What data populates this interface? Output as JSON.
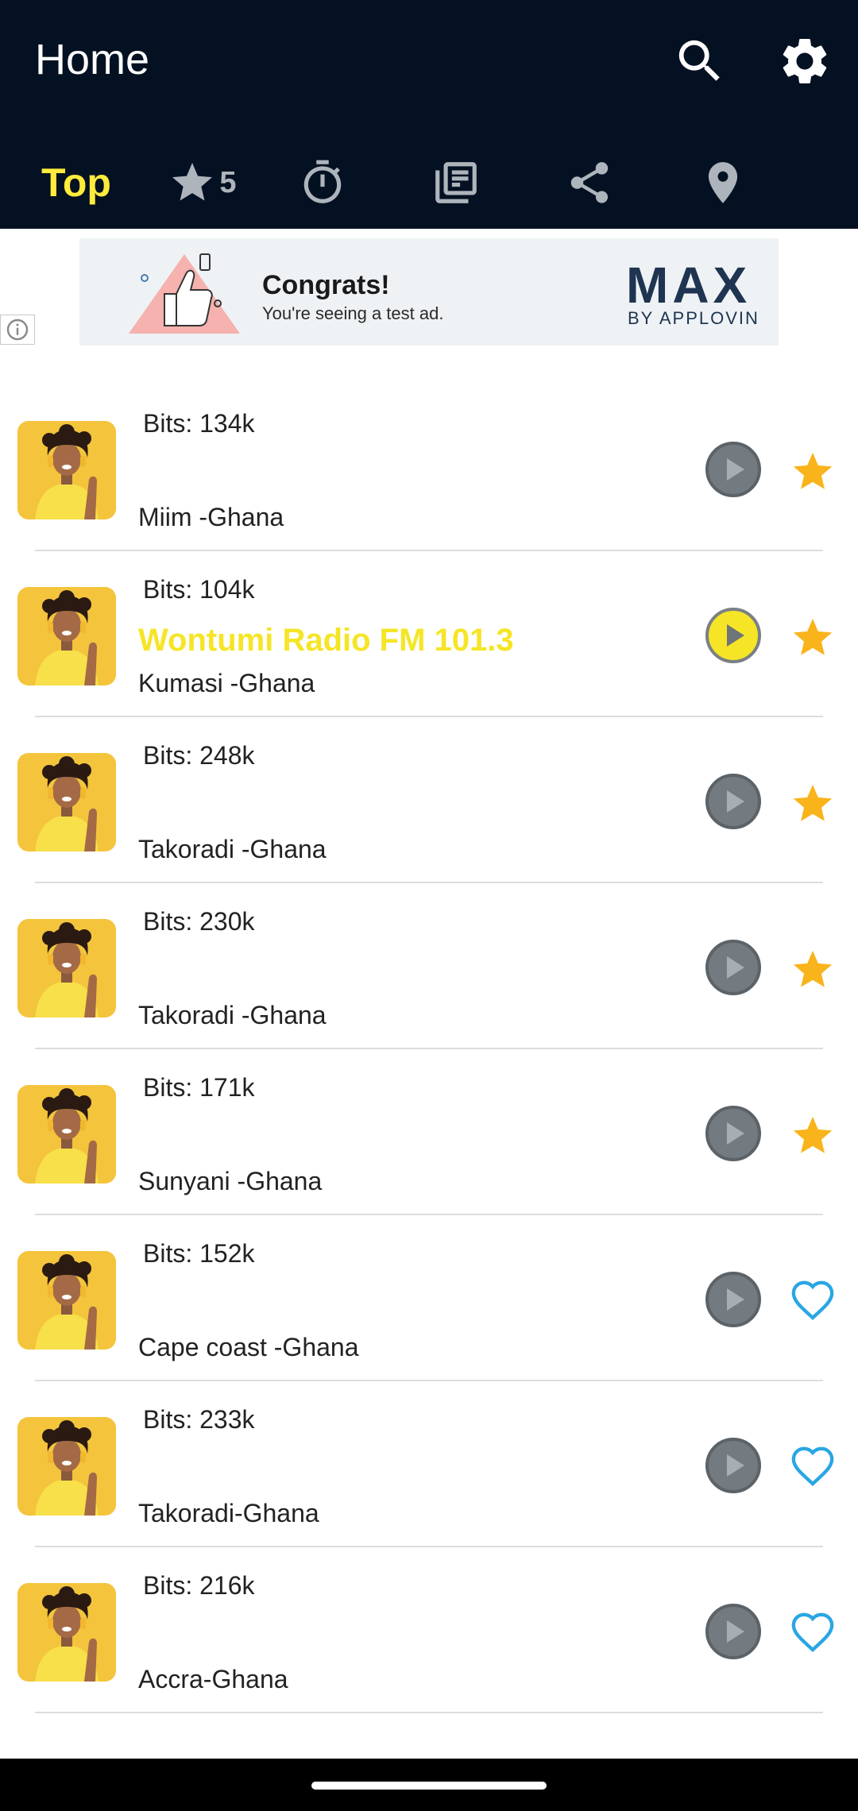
{
  "header": {
    "title": "Home"
  },
  "tabs": {
    "top_label": "Top",
    "favorites_count": "5"
  },
  "ad": {
    "headline": "Congrats!",
    "subtext": "You're seeing a test ad.",
    "brand": "MAX",
    "brand_sub": "BY APPLOVIN"
  },
  "stations": [
    {
      "bits": "Bits: 134k",
      "name": "",
      "location": "Miim -Ghana",
      "favorite": "star",
      "playing": false
    },
    {
      "bits": "Bits: 104k",
      "name": "Wontumi Radio FM 101.3",
      "location": "Kumasi -Ghana",
      "favorite": "star",
      "playing": true
    },
    {
      "bits": "Bits: 248k",
      "name": "",
      "location": "Takoradi -Ghana",
      "favorite": "star",
      "playing": false
    },
    {
      "bits": "Bits: 230k",
      "name": "",
      "location": "Takoradi -Ghana",
      "favorite": "star",
      "playing": false
    },
    {
      "bits": "Bits: 171k",
      "name": "",
      "location": "Sunyani -Ghana",
      "favorite": "star",
      "playing": false
    },
    {
      "bits": "Bits: 152k",
      "name": "",
      "location": "Cape coast -Ghana",
      "favorite": "heart",
      "playing": false
    },
    {
      "bits": "Bits: 233k",
      "name": "",
      "location": "Takoradi-Ghana",
      "favorite": "heart",
      "playing": false
    },
    {
      "bits": "Bits: 216k",
      "name": "",
      "location": "Accra-Ghana",
      "favorite": "heart",
      "playing": false
    }
  ],
  "colors": {
    "appbar": "#041122",
    "accent_yellow": "#f5e526",
    "star": "#f9b31b",
    "heart": "#29a6e4"
  }
}
